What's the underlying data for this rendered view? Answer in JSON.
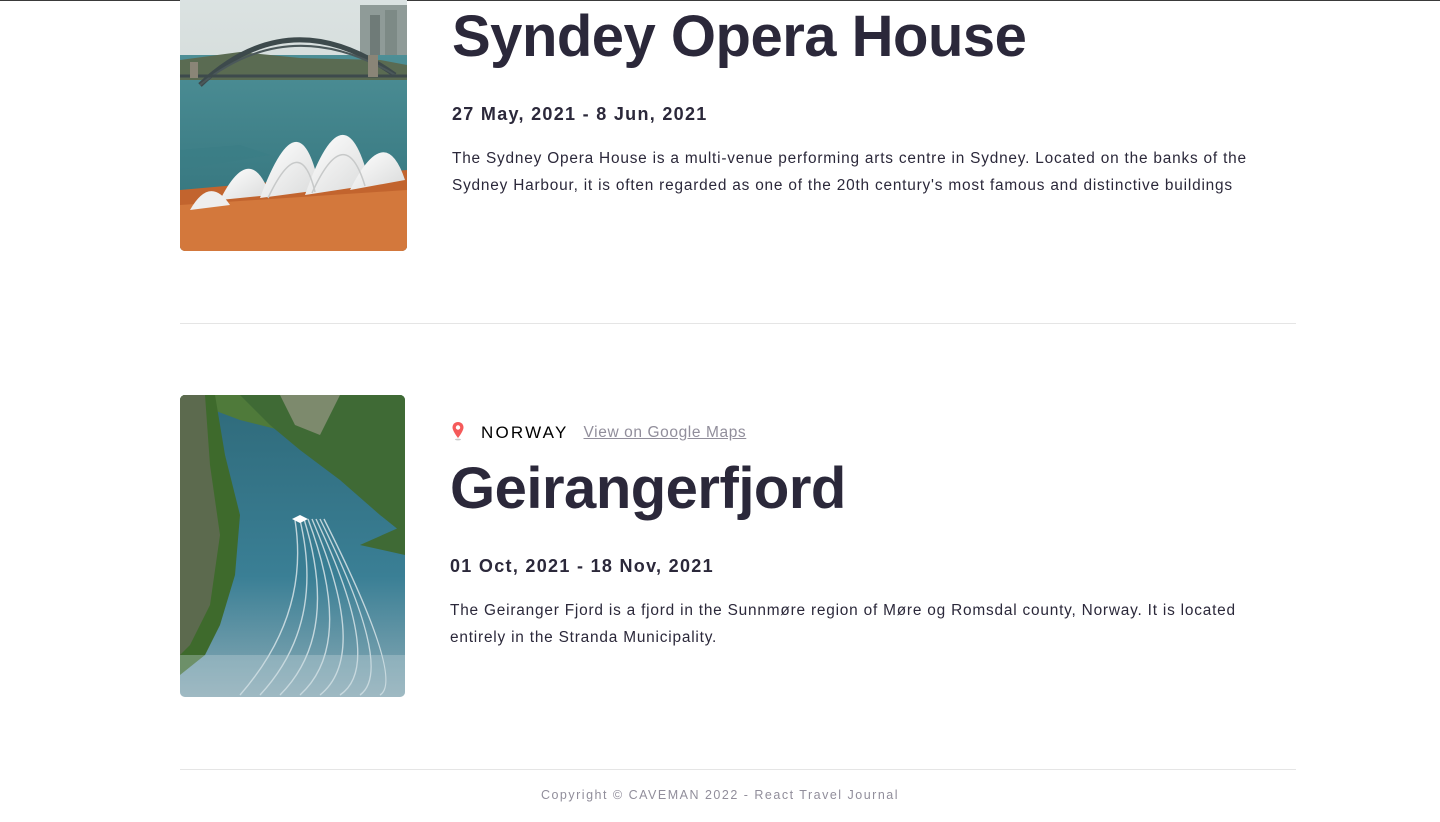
{
  "entries": [
    {
      "title": "Syndey Opera House",
      "dates": "27 May, 2021 - 8 Jun, 2021",
      "description": "The Sydney Opera House is a multi-venue performing arts centre in Sydney. Located on the banks of the Sydney Harbour, it is often regarded as one of the 20th century's most famous and distinctive buildings",
      "image_subject": "sydney-opera-house-photo"
    },
    {
      "location": "NORWAY",
      "map_link_label": "View on Google Maps",
      "title": "Geirangerfjord",
      "dates": "01 Oct, 2021 - 18 Nov, 2021",
      "description": "The Geiranger Fjord is a fjord in the Sunnmøre region of Møre og Romsdal county, Norway. It is located entirely in the Stranda Municipality.",
      "image_subject": "geirangerfjord-photo"
    }
  ],
  "icons": {
    "location": "map-pin-icon"
  },
  "colors": {
    "title": "#2b283a",
    "muted": "#918e9b",
    "pin": "#f55a5a",
    "divider": "#e5e5e5"
  },
  "footer": {
    "text": "Copyright © CAVEMAN 2022 - React Travel Journal"
  }
}
